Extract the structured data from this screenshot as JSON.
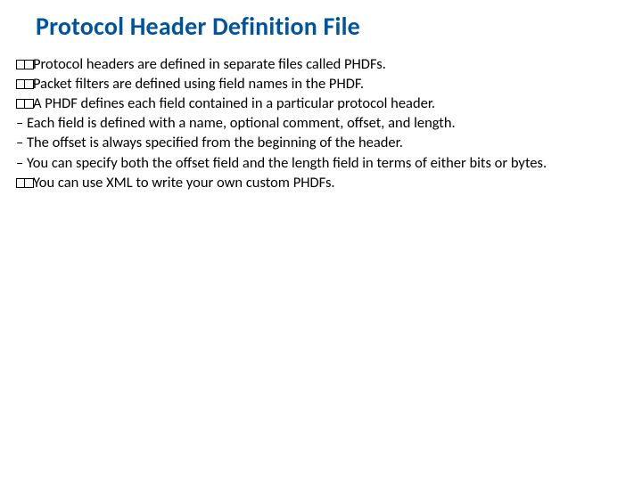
{
  "title": "Protocol Header Definition File",
  "lines": {
    "l1": "Protocol headers are defined in separate files called PHDFs.",
    "l2": "Packet filters are defined using field names in the PHDF.",
    "l3": "A PHDF defines each field contained in a particular protocol header.",
    "l4": "– Each field is defined with a name, optional comment, offset, and length.",
    "l5": "– The offset is always specified from the beginning of the header.",
    "l6": "– You can specify both the offset field and the length field in terms of either bits or bytes.",
    "l7": "You can use XML to write your own custom PHDFs."
  }
}
